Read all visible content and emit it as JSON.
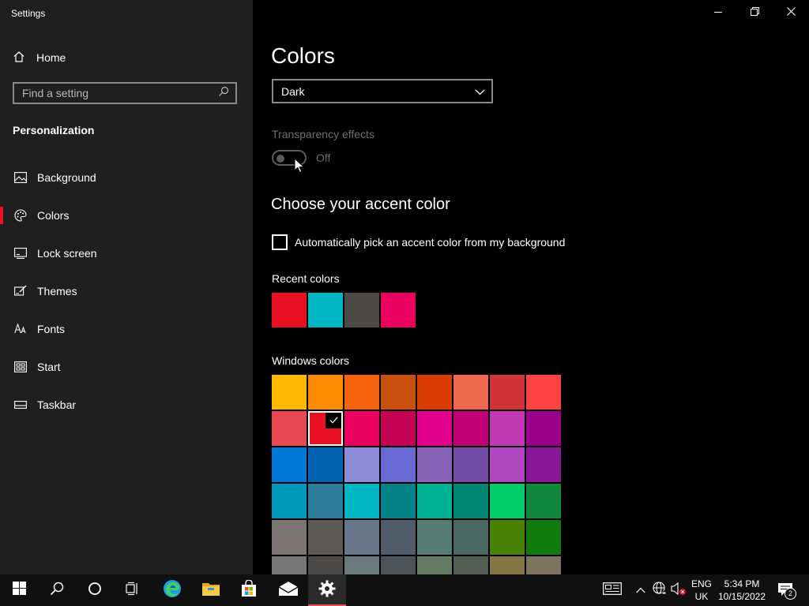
{
  "window": {
    "title": "Settings"
  },
  "sidebar": {
    "home_label": "Home",
    "search_placeholder": "Find a setting",
    "section_label": "Personalization",
    "items": [
      {
        "label": "Background",
        "icon": "picture-icon"
      },
      {
        "label": "Colors",
        "icon": "palette-icon",
        "active": true
      },
      {
        "label": "Lock screen",
        "icon": "lock-screen-icon"
      },
      {
        "label": "Themes",
        "icon": "brush-icon"
      },
      {
        "label": "Fonts",
        "icon": "font-icon"
      },
      {
        "label": "Start",
        "icon": "start-icon"
      },
      {
        "label": "Taskbar",
        "icon": "taskbar-icon"
      }
    ]
  },
  "main": {
    "title": "Colors",
    "mode_select": {
      "value": "Dark"
    },
    "transparency": {
      "label": "Transparency effects",
      "state": "Off"
    },
    "accent_heading": "Choose your accent color",
    "auto_pick_label": "Automatically pick an accent color from my background",
    "recent_label": "Recent colors",
    "recent_colors": [
      "#e81123",
      "#00b7c3",
      "#4c4a48",
      "#ea005e"
    ],
    "windows_label": "Windows colors",
    "windows_colors": [
      "#ffb900",
      "#ff8c00",
      "#f7630c",
      "#ca5010",
      "#da3b01",
      "#ef6950",
      "#d13438",
      "#ff4343",
      "#e74856",
      "#e81123",
      "#ea005e",
      "#c30052",
      "#e3008c",
      "#bf0077",
      "#c239b3",
      "#9a0089",
      "#0078d7",
      "#0063b1",
      "#8e8cd8",
      "#6b69d6",
      "#8764b8",
      "#744da9",
      "#b146c2",
      "#881798",
      "#0099bc",
      "#2d7d9a",
      "#00b7c3",
      "#038387",
      "#00b294",
      "#018574",
      "#00cc6a",
      "#10893e",
      "#7a7574",
      "#5d5a58",
      "#68768a",
      "#515c6b",
      "#567c73",
      "#486860",
      "#498205",
      "#107c10",
      "#767676",
      "#4c4a48",
      "#69797e",
      "#4a5459",
      "#647c64",
      "#525e54",
      "#847545",
      "#7e735f"
    ],
    "selected_color": "#e81123"
  },
  "taskbar": {
    "apps": [
      "windows-start-icon",
      "search-icon",
      "cortana-icon",
      "task-view-icon",
      "edge-icon",
      "file-explorer-icon",
      "store-icon",
      "mail-icon",
      "settings-gear-icon"
    ],
    "language": {
      "line1": "ENG",
      "line2": "UK"
    },
    "clock": {
      "time": "5:34 PM",
      "date": "10/15/2022"
    },
    "notification_count": "2"
  },
  "colors": {
    "sidebar_bg": "#1f1f1f",
    "main_bg": "#000000",
    "accent": "#e81123",
    "taskbar_bg": "#101010"
  }
}
